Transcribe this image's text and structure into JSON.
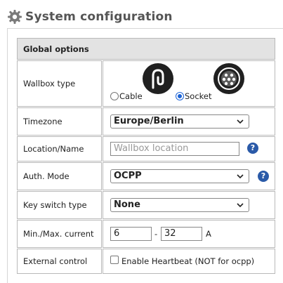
{
  "header": {
    "title": "System configuration"
  },
  "section": {
    "title": "Global options"
  },
  "wallbox": {
    "label": "Wallbox type",
    "options": [
      {
        "label": "Cable",
        "checked": false
      },
      {
        "label": "Socket",
        "checked": true
      }
    ]
  },
  "timezone": {
    "label": "Timezone",
    "value": "Europe/Berlin"
  },
  "location": {
    "label": "Location/Name",
    "placeholder": "Wallbox location"
  },
  "auth": {
    "label": "Auth. Mode",
    "value": "OCPP"
  },
  "keyswitch": {
    "label": "Key switch type",
    "value": "None"
  },
  "current": {
    "label": "Min./Max. current",
    "min": "6",
    "separator": "-",
    "max": "32",
    "unit": "A"
  },
  "external": {
    "label": "External control",
    "checkbox_label": "Enable Heartbeat (NOT for ocpp)",
    "checked": false
  },
  "icons": {
    "help": "?"
  },
  "colors": {
    "accent": "#1a62d6",
    "help": "#2a5aa8",
    "header_bg": "#e3e3e3"
  }
}
